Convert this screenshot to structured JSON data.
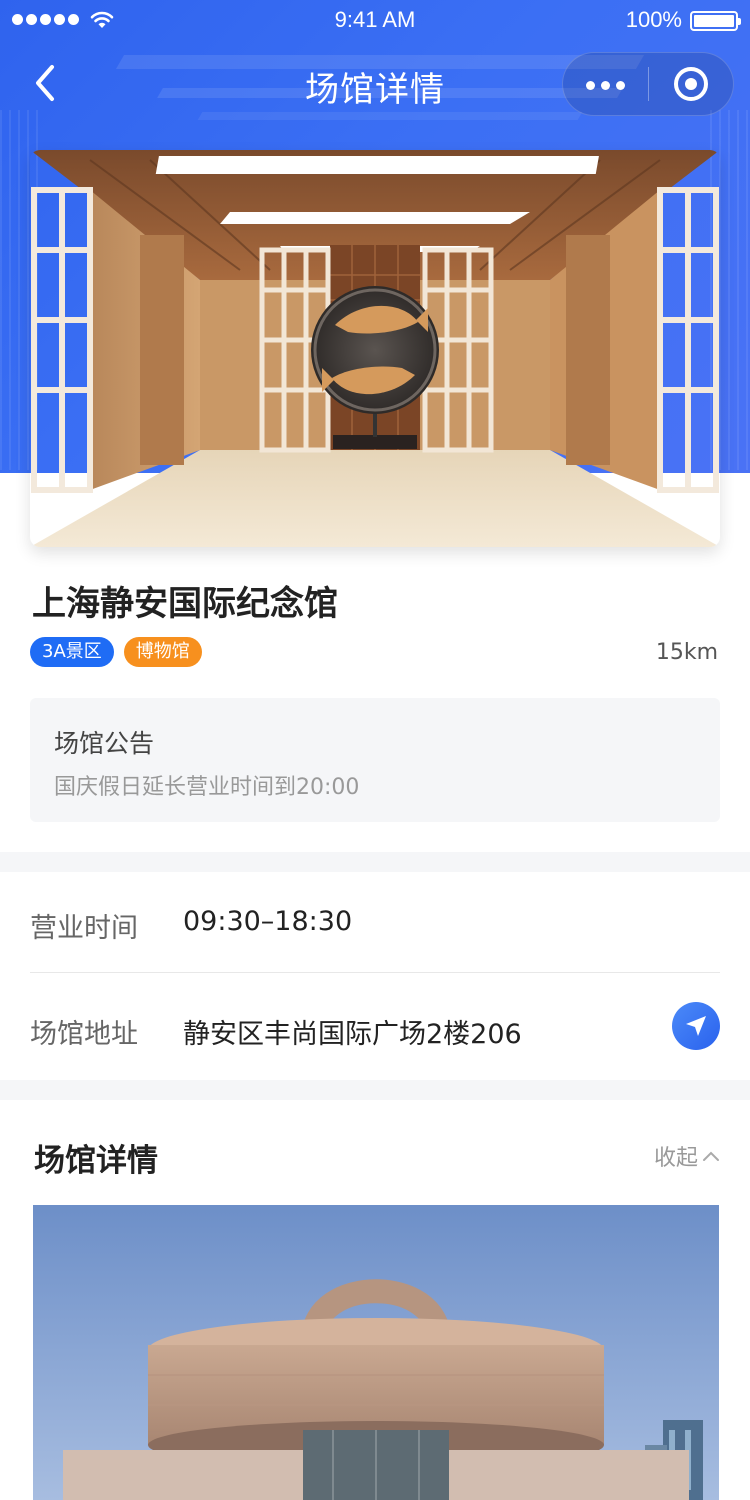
{
  "status_bar": {
    "time": "9:41 AM",
    "battery": "100%",
    "icons": [
      "signal-dots-icon",
      "wifi-icon",
      "battery-icon"
    ]
  },
  "nav": {
    "title": "场馆详情",
    "icons": [
      "back-chevron-icon",
      "more-dots-icon",
      "close-target-icon"
    ]
  },
  "venue": {
    "name": "上海静安国际纪念馆",
    "tags": [
      {
        "label": "3A景区",
        "color": "#1f6cf5"
      },
      {
        "label": "博物馆",
        "color": "#f7901e"
      }
    ],
    "distance": "15km"
  },
  "notice": {
    "title": "场馆公告",
    "text": "国庆假日延长营业时间到20:00"
  },
  "info": {
    "hours_label": "营业时间",
    "hours_value": "09:30–18:30",
    "address_label": "场馆地址",
    "address_value": "静安区丰尚国际广场2楼206",
    "navigate_icon": "navigation-arrow-icon"
  },
  "detail_section": {
    "title": "场馆详情",
    "collapse_label": "收起",
    "collapse_icon": "chevron-up-icon"
  },
  "colors": {
    "header_blue": "#2f63ee",
    "tag_blue": "#1f6cf5",
    "tag_orange": "#f7901e",
    "separator": "#f5f6f8"
  }
}
